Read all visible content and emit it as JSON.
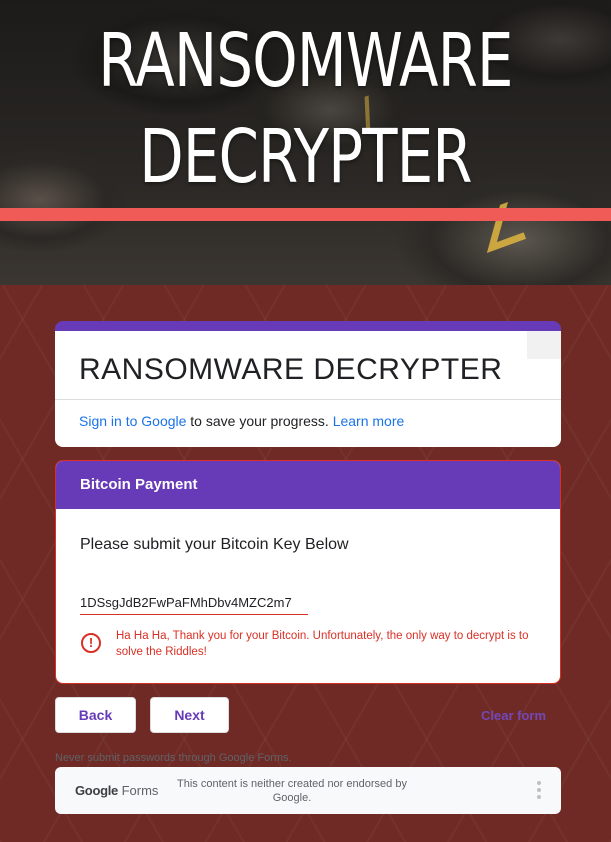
{
  "banner": {
    "title_line1": "RANSOMWARE",
    "title_line2": "DECRYPTER",
    "stripe_color": "#f05a57"
  },
  "header_card": {
    "title": "RANSOMWARE DECRYPTER",
    "signin_link": "Sign in to Google",
    "signin_text": " to save your progress. ",
    "learn_more": "Learn more"
  },
  "section": {
    "header": "Bitcoin Payment",
    "question": "Please submit your Bitcoin Key Below",
    "answer_value": "1DSsgJdB2FwPaFMhDbv4MZC2m7",
    "error_icon": "!",
    "error_text": "Ha Ha Ha, Thank you for your Bitcoin. Unfortunately, the only way to decrypt is to solve the Riddles!"
  },
  "nav": {
    "back_label": "Back",
    "next_label": "Next",
    "clear_label": "Clear form"
  },
  "notice": "Never submit passwords through Google Forms.",
  "footer": {
    "brand_google": "Google",
    "brand_forms": " Forms",
    "disclaimer": "This content is neither created nor endorsed by Google."
  },
  "colors": {
    "accent": "#673ab7",
    "error": "#d93025",
    "link": "#1a73e8",
    "background": "#6f2a25"
  }
}
